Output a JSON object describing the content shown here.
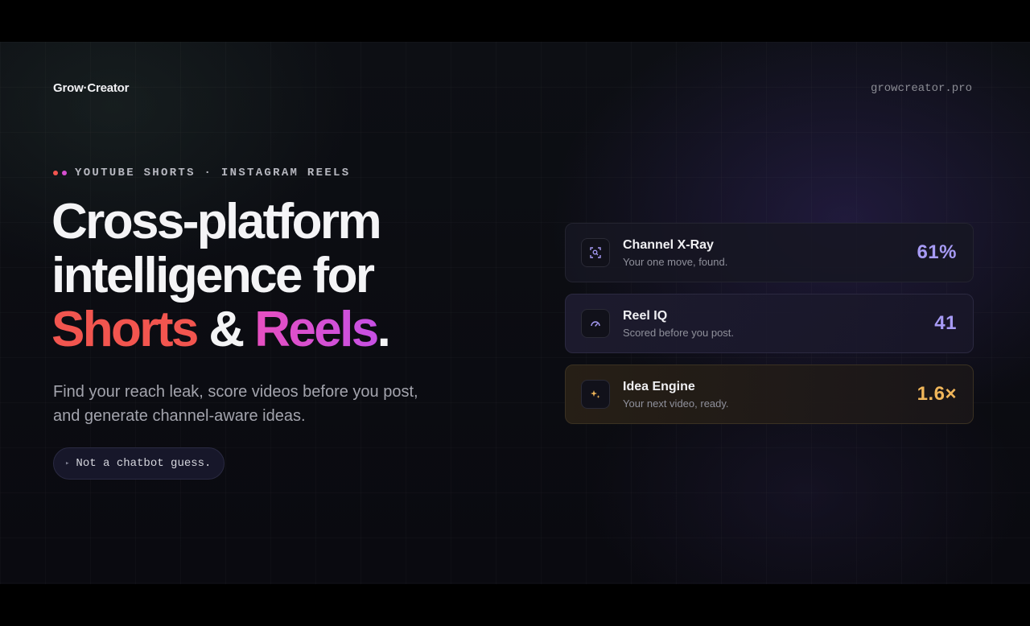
{
  "brand": "Grow·Creator",
  "domain": "growcreator.pro",
  "eyebrow": {
    "text": "YOUTUBE SHORTS · INSTAGRAM REELS",
    "dot_colors": [
      "#f2554f",
      "#d64fd0"
    ]
  },
  "headline": {
    "line1": "Cross-platform",
    "line2": "intelligence for",
    "shorts": "Shorts",
    "amp": " & ",
    "reels": "Reels",
    "period": "."
  },
  "subtitle": "Find your reach leak, score videos before you post, and generate channel-aware ideas.",
  "pill": {
    "arrow": "▸",
    "text": "Not a chatbot guess."
  },
  "cards": [
    {
      "title": "Channel X-Ray",
      "subtitle": "Your one move, found.",
      "value": "61%",
      "value_color": "#a79bf5",
      "icon": "scan-icon"
    },
    {
      "title": "Reel IQ",
      "subtitle": "Scored before you post.",
      "value": "41",
      "value_color": "#a79bf5",
      "icon": "gauge-icon"
    },
    {
      "title": "Idea Engine",
      "subtitle": "Your next video, ready.",
      "value": "1.6×",
      "value_color": "#f0b65a",
      "icon": "sparkle-icon"
    }
  ]
}
